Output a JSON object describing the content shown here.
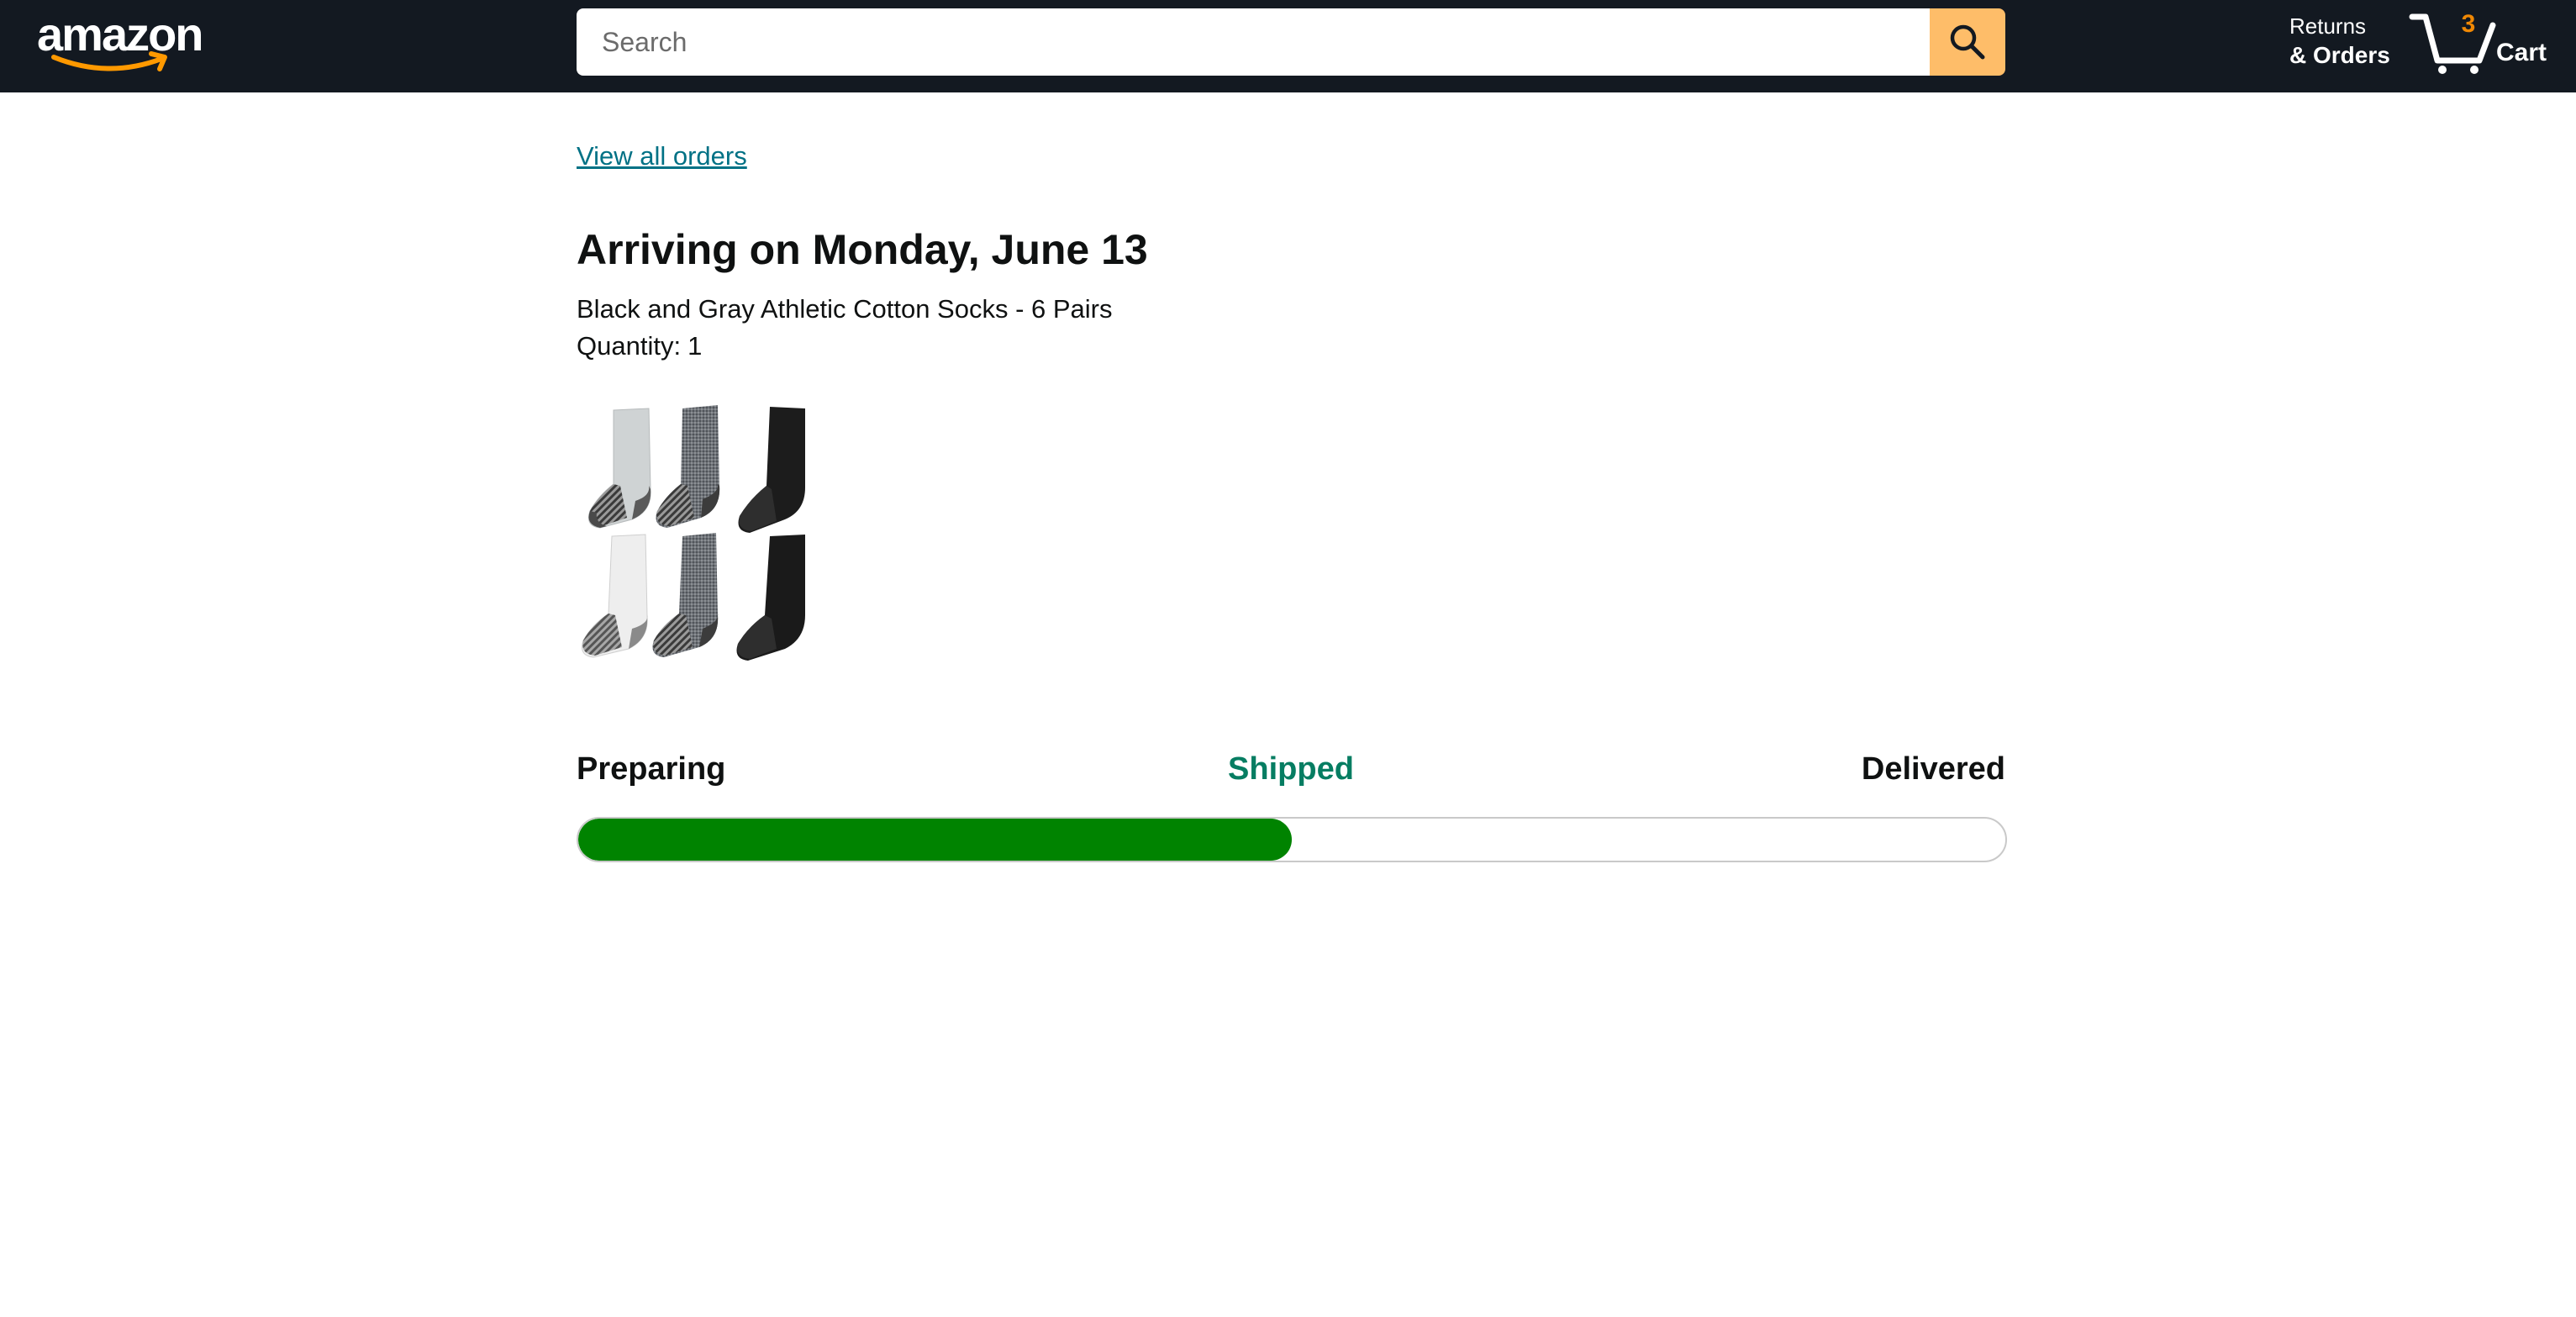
{
  "header": {
    "logo_text": "amazon",
    "search": {
      "placeholder": "Search",
      "value": ""
    },
    "returns_top": "Returns",
    "returns_bottom": "& Orders",
    "cart_count": "3",
    "cart_label": "Cart"
  },
  "colors": {
    "header_bg": "#131921",
    "search_button": "#febd69",
    "link": "#007185",
    "shipped_text": "#067d62",
    "progress_fill": "#008300",
    "cart_count": "#f08804"
  },
  "order": {
    "view_all_link": "View all orders",
    "arriving_text": "Arriving on Monday, June 13",
    "product_name": "Black and Gray Athletic Cotton Socks - 6 Pairs",
    "quantity_label": "Quantity:",
    "quantity_value": "1"
  },
  "tracking": {
    "steps": [
      "Preparing",
      "Shipped",
      "Delivered"
    ],
    "current_step": "Shipped",
    "progress_fraction": 0.5
  },
  "icons": [
    "search-icon",
    "cart-icon",
    "amazon-smile-logo"
  ]
}
